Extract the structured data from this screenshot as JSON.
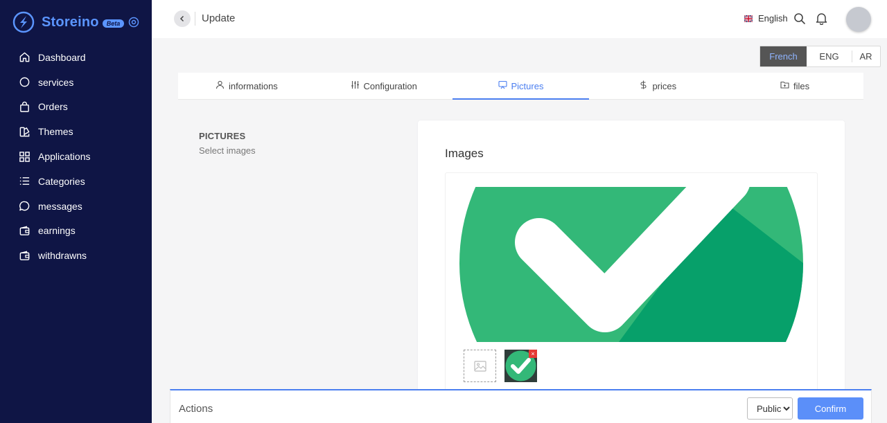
{
  "brand": {
    "name": "Storeino",
    "badge": "Beta"
  },
  "sidebar": {
    "items": [
      {
        "label": "Dashboard",
        "icon": "home-icon"
      },
      {
        "label": "services",
        "icon": "circle-icon"
      },
      {
        "label": "Orders",
        "icon": "shopping-bag-icon"
      },
      {
        "label": "Themes",
        "icon": "palette-icon"
      },
      {
        "label": "Applications",
        "icon": "grid-icon"
      },
      {
        "label": "Categories",
        "icon": "list-icon"
      },
      {
        "label": "messages",
        "icon": "chat-bubble-icon"
      },
      {
        "label": "earnings",
        "icon": "wallet-icon"
      },
      {
        "label": "withdrawns",
        "icon": "wallet-icon"
      }
    ]
  },
  "header": {
    "title": "Update",
    "language": "English"
  },
  "content_languages": [
    "French",
    "ENG",
    "AR"
  ],
  "active_content_language": "French",
  "tabs": [
    {
      "label": "informations",
      "icon": "user-icon"
    },
    {
      "label": "Configuration",
      "icon": "sliders-icon"
    },
    {
      "label": "Pictures",
      "icon": "monitor-icon",
      "active": true
    },
    {
      "label": "prices",
      "icon": "dollar-icon"
    },
    {
      "label": "files",
      "icon": "folder-icon"
    }
  ],
  "section": {
    "title": "PICTURES",
    "subtitle": "Select images"
  },
  "images_card": {
    "title": "Images",
    "remove_symbol": "×"
  },
  "actions": {
    "label": "Actions",
    "visibility": "Public",
    "confirm_label": "Confirm"
  },
  "colors": {
    "sidebar_bg": "#0f1545",
    "brand_accent": "#5b95ff",
    "primary": "#4a7ef0",
    "check_green_light": "#33b878",
    "check_green_dark": "#07a06a",
    "remove_red": "#e53935"
  }
}
